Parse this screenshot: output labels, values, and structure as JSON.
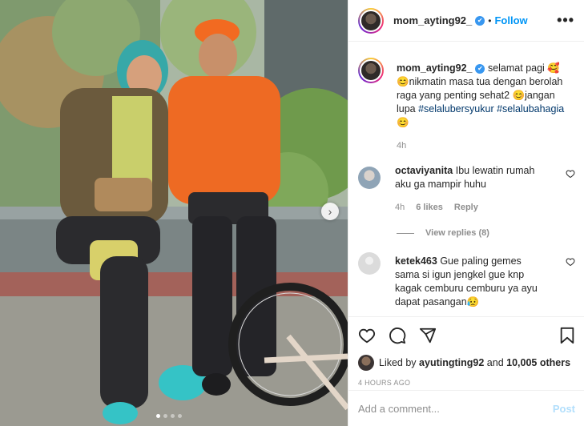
{
  "post": {
    "username": "mom_ayting92_",
    "verified_mark": "✔",
    "separator": "•",
    "follow_label": "Follow",
    "more_label": "•••",
    "carousel": {
      "next_label": "›",
      "slides": 4,
      "active_index": 0
    }
  },
  "caption": {
    "username": "mom_ayting92_",
    "text_1": " selamat pagi 🥰",
    "text_2": "😊nikmatin masa tua dengan berolah raga yang penting sehat2 😊jangan lupa ",
    "hashtag_1": "#selalubersyukur",
    "hashtag_2": "#selalubahagia",
    "text_3": "😊",
    "time": "4h"
  },
  "comments": [
    {
      "username": "octaviyanita",
      "text": "Ibu lewatin rumah aku ga mampir huhu",
      "time": "4h",
      "likes": "6 likes",
      "reply_label": "Reply",
      "view_replies": "View replies (8)"
    },
    {
      "username": "ketek463",
      "text": "Gue paling gemes sama si igun jengkel gue knp kagak cemburu cemburu ya ayu dapat pasangan😥"
    }
  ],
  "likes": {
    "prefix": "Liked by ",
    "user": "ayutingting92",
    "middle": " and ",
    "count": "10,005 others"
  },
  "timestamp": "4 HOURS AGO",
  "add_comment": {
    "placeholder": "Add a comment...",
    "post_label": "Post"
  },
  "colors": {
    "accent": "#0095f6",
    "verified": "#3897f0",
    "meta": "#8e8e8e",
    "post_disabled": "#b2dffc"
  }
}
